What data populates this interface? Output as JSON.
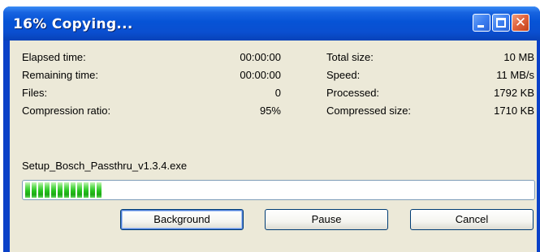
{
  "window": {
    "title": "16% Copying...",
    "controls": [
      "minimize-icon",
      "maximize-icon",
      "close-icon"
    ]
  },
  "stats_left": [
    {
      "label": "Elapsed time:",
      "value": "00:00:00"
    },
    {
      "label": "Remaining time:",
      "value": "00:00:00"
    },
    {
      "label": "Files:",
      "value": "0"
    },
    {
      "label": "Compression ratio:",
      "value": "95%"
    }
  ],
  "stats_right": [
    {
      "label": "Total size:",
      "value": "10 MB"
    },
    {
      "label": "Speed:",
      "value": "11 MB/s"
    },
    {
      "label": "Processed:",
      "value": "1792 KB"
    },
    {
      "label": "Compressed size:",
      "value": "1710 KB"
    }
  ],
  "current_file": "Setup_Bosch_Passthru_v1.3.4.exe",
  "progress": {
    "percent": 16,
    "fill_color": "#26c41e"
  },
  "buttons": {
    "background": "Background",
    "pause": "Pause",
    "cancel": "Cancel"
  }
}
